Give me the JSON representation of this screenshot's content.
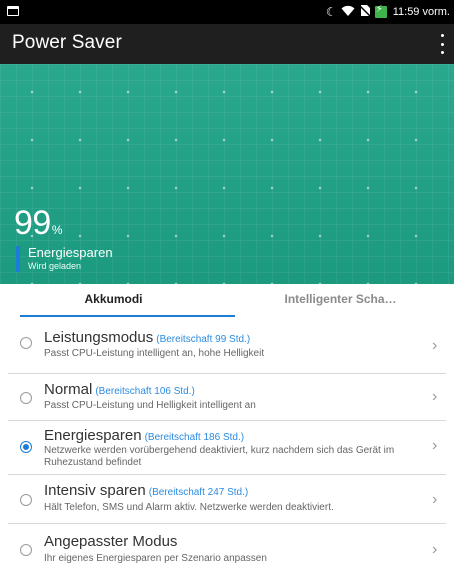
{
  "status_bar": {
    "time": "11:59 vorm.",
    "icons": [
      "notification-icon",
      "moon-icon",
      "wifi-icon",
      "no-sim-icon",
      "battery-charging-icon"
    ]
  },
  "app_bar": {
    "title": "Power Saver"
  },
  "hero": {
    "battery_percent": "99",
    "percent_unit": "%",
    "current_mode": "Energiesparen",
    "charging_status": "Wird geladen",
    "accent_color": "#21a388"
  },
  "tabs": [
    {
      "label": "Akkumodi",
      "selected": true
    },
    {
      "label": "Intelligenter Scha…",
      "selected": false
    }
  ],
  "modes": [
    {
      "title": "Leistungsmodus",
      "standby": "(Bereitschaft 99 Std.)",
      "desc": "Passt CPU-Leistung intelligent an, hohe Helligkeit",
      "selected": false
    },
    {
      "title": "Normal",
      "standby": "(Bereitschaft 106 Std.)",
      "desc": "Passt CPU-Leistung und Helligkeit intelligent an",
      "selected": false
    },
    {
      "title": "Energiesparen",
      "standby": "(Bereitschaft 186 Std.)",
      "desc": "Netzwerke werden vorübergehend deaktiviert, kurz nachdem sich das Gerät im Ruhezustand befindet",
      "selected": true
    },
    {
      "title": "Intensiv sparen",
      "standby": "(Bereitschaft 247 Std.)",
      "desc": "Hält Telefon, SMS und Alarm aktiv. Netzwerke werden deaktiviert.",
      "selected": false
    },
    {
      "title": "Angepasster Modus",
      "standby": "",
      "desc": "Ihr eigenes Energiesparen per Szenario anpassen",
      "selected": false
    }
  ],
  "colors": {
    "selection_blue": "#1b7dd8",
    "standby_blue": "#2c8be0"
  }
}
